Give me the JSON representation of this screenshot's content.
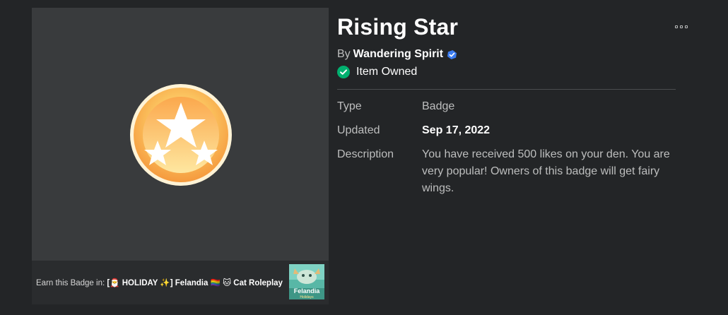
{
  "item": {
    "title": "Rising Star",
    "by_prefix": "By",
    "creator": "Wandering Spirit",
    "owned_status": "Item Owned"
  },
  "earn": {
    "prefix": "Earn this Badge in:",
    "game_name": "[🎅 HOLIDAY ✨] Felandia 🏳️‍🌈 🐱 Cat Roleplay",
    "game_thumb_text_1": "Felandia",
    "game_thumb_text_2": "Holidays"
  },
  "details": {
    "type_label": "Type",
    "type_value": "Badge",
    "updated_label": "Updated",
    "updated_value": "Sep 17, 2022",
    "description_label": "Description",
    "description_value": "You have received 500 likes on your den. You are very popular! Owners of this badge will get fairy wings."
  },
  "colors": {
    "background": "#232527",
    "panel": "#393b3d",
    "owned_check": "#00b06f",
    "verified": "#3b7cf0",
    "badge_orange": "#f7a34a",
    "badge_yellow": "#fde08a"
  },
  "icons": {
    "more": "more-options-icon",
    "verified": "verified-badge-icon",
    "owned": "checkmark-circle-icon",
    "badge": "star-badge-icon"
  }
}
